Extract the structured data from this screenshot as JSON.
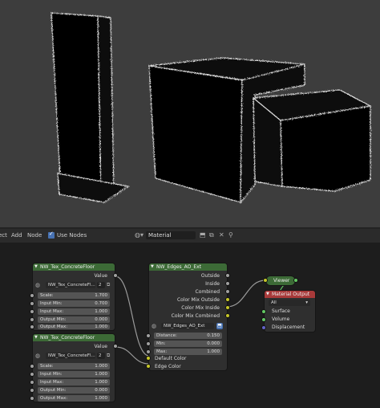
{
  "header": {
    "menu": [
      "ect",
      "Add",
      "Node"
    ],
    "use_nodes_label": "Use Nodes",
    "material_name": "Material"
  },
  "nodes": {
    "tex1": {
      "title": "NW_Tex_ConcreteFloor",
      "output_label": "Value",
      "datablock": "NW_Tex_ConcreteFl...",
      "users": "2",
      "inputs": [
        {
          "label": "Scale:",
          "value": "1.700"
        },
        {
          "label": "Input Min:",
          "value": "0.700"
        },
        {
          "label": "Input Max:",
          "value": "1.000"
        },
        {
          "label": "Output Min:",
          "value": "0.000"
        },
        {
          "label": "Output Max:",
          "value": "1.000"
        }
      ]
    },
    "tex2": {
      "title": "NW_Tex_ConcreteFloor",
      "output_label": "Value",
      "datablock": "NW_Tex_ConcreteFl...",
      "users": "2",
      "inputs": [
        {
          "label": "Scale:",
          "value": "1.000"
        },
        {
          "label": "Input Min:",
          "value": "1.000"
        },
        {
          "label": "Input Max:",
          "value": "1.000"
        },
        {
          "label": "Output Min:",
          "value": "0.000"
        },
        {
          "label": "Output Max:",
          "value": "1.000"
        }
      ]
    },
    "edges": {
      "title": "NW_Edges_AO_Ext",
      "outputs": [
        "Outside",
        "Inside",
        "Combined",
        "Color Mix Outside",
        "Color Mix Inside",
        "Color Mix Combined"
      ],
      "datablock": "NW_Edges_AO_Ext",
      "inputs": [
        {
          "label": "Distance:",
          "value": "0.150"
        },
        {
          "label": "Min:",
          "value": "0.000"
        },
        {
          "label": "Max:",
          "value": "1.000"
        }
      ],
      "color_inputs": [
        "Default Color",
        "Edge Color"
      ]
    },
    "viewer": {
      "title": "Viewer"
    },
    "material_output": {
      "title": "Material Output",
      "target": "All",
      "inputs": [
        "Surface",
        "Volume",
        "Displacement"
      ]
    }
  }
}
